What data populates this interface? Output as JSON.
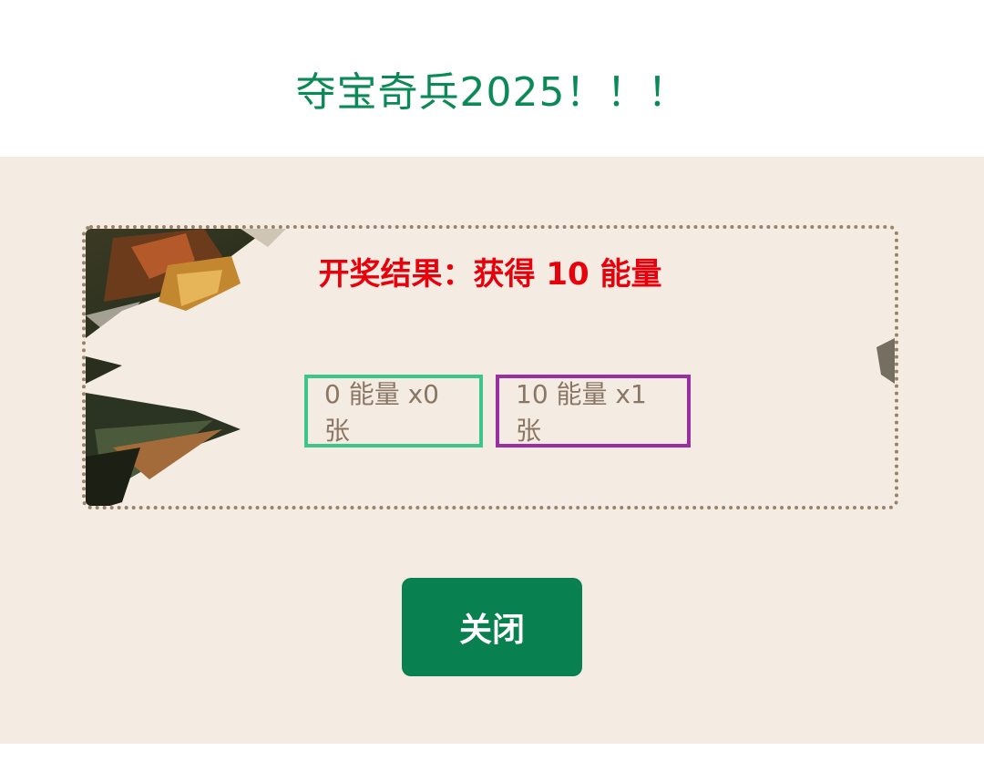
{
  "header": {
    "title": "夺宝奇兵2025！！！"
  },
  "result": {
    "text": "开奖结果：获得 10 能量"
  },
  "tiers": [
    {
      "label": "0 能量 x0张",
      "color": "#3ec58a"
    },
    {
      "label": "10 能量 x1张",
      "color": "#9b2fa0"
    }
  ],
  "actions": {
    "close_label": "关闭"
  },
  "colors": {
    "title": "#0b8a58",
    "result": "#e8000b",
    "button": "#08804f",
    "background": "#f4ebe2"
  }
}
